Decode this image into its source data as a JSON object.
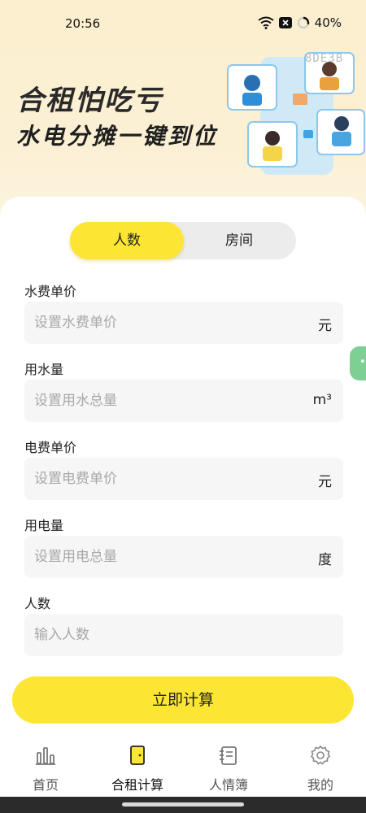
{
  "status_bar": {
    "time": "20:56",
    "battery": "40%"
  },
  "banner": {
    "title": "合租怕吃亏",
    "subtitle": "水电分摊一键到位",
    "code": "8DE3B"
  },
  "mode_toggle": {
    "options": [
      "人数",
      "房间"
    ],
    "selected": "人数"
  },
  "fields": [
    {
      "label": "水费单价",
      "placeholder": "设置水费单价",
      "unit": "元"
    },
    {
      "label": "用水量",
      "placeholder": "设置用水总量",
      "unit": "m³"
    },
    {
      "label": "电费单价",
      "placeholder": "设置电费单价",
      "unit": "元"
    },
    {
      "label": "用电量",
      "placeholder": "设置用电总量",
      "unit": "度"
    },
    {
      "label": "人数",
      "placeholder": "输入人数",
      "unit": ""
    }
  ],
  "calculate_button": "立即计算",
  "tabs": [
    {
      "label": "首页",
      "icon": "chart-icon"
    },
    {
      "label": "合租计算",
      "icon": "door-icon"
    },
    {
      "label": "人情簿",
      "icon": "notebook-icon"
    },
    {
      "label": "我的",
      "icon": "gear-icon"
    }
  ],
  "active_tab": "合租计算",
  "colors": {
    "accent": "#fde533",
    "background_top": "#fbefcf",
    "field_bg": "#f6f6f6",
    "side_handle": "#7ecf93"
  }
}
